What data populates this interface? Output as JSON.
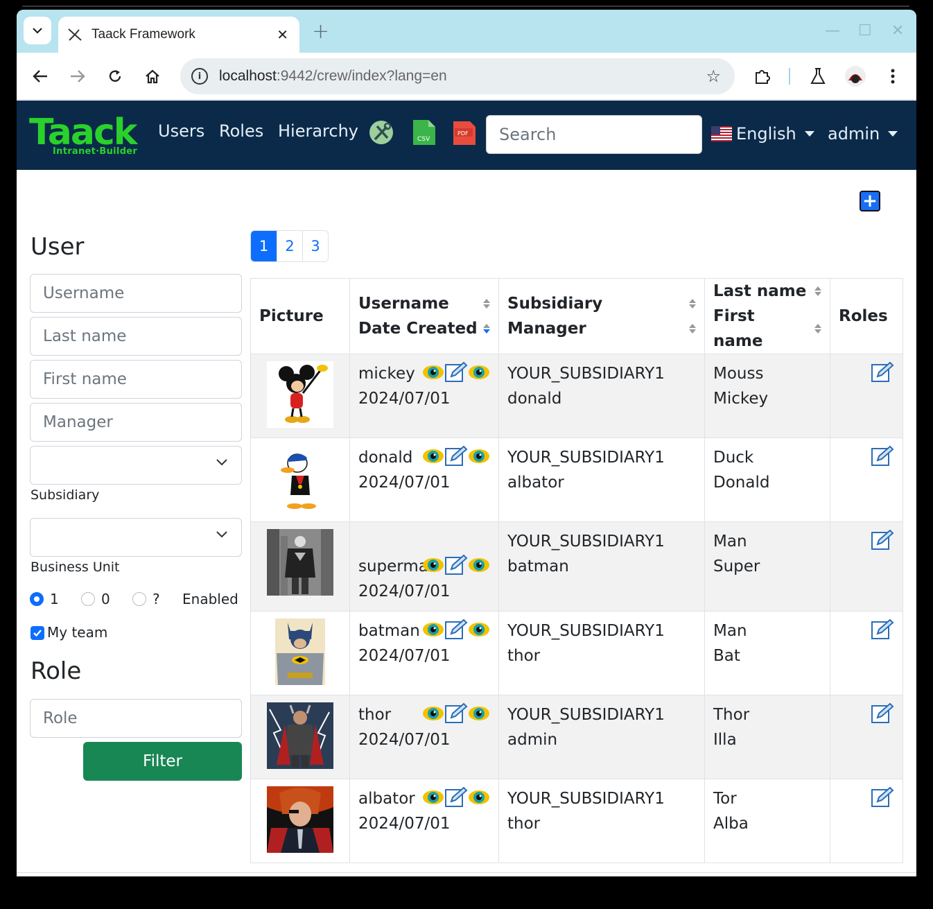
{
  "browser": {
    "tab_title": "Taack Framework",
    "url_host": "localhost",
    "url_rest": ":9442/crew/index?lang=en"
  },
  "app": {
    "logo_main": "Taack",
    "logo_sub": "Intranet·Builder",
    "nav": [
      "Users",
      "Roles",
      "Hierarchy"
    ],
    "search_placeholder": "Search",
    "language": "English",
    "user": "admin",
    "colors": {
      "navbar": "#0b2a4a",
      "logo": "#2bd12b",
      "primary": "#0d6efd",
      "filter_button": "#198754"
    }
  },
  "filter": {
    "user_title": "User",
    "fields": [
      "Username",
      "Last name",
      "First name",
      "Manager"
    ],
    "subsidiary_label": "Subsidiary",
    "business_unit_label": "Business Unit",
    "enabled_options": [
      "1",
      "0",
      "?"
    ],
    "enabled_selected": "1",
    "enabled_label": "Enabled",
    "my_team_label": "My team",
    "my_team_checked": true,
    "role_title": "Role",
    "role_placeholder": "Role",
    "filter_button": "Filter"
  },
  "pagination": {
    "pages": [
      "1",
      "2",
      "3"
    ],
    "active": "1"
  },
  "table": {
    "headers": {
      "picture": "Picture",
      "username": "Username",
      "date_created": "Date Created",
      "subsidiary": "Subsidiary",
      "manager": "Manager",
      "last_name": "Last name",
      "first_name": "First name",
      "roles": "Roles"
    },
    "rows": [
      {
        "username": "mickey",
        "date": "2024/07/01",
        "subsidiary": "YOUR_SUBSIDIARY1",
        "manager": "donald",
        "last_name": "Mouss",
        "first_name": "Mickey",
        "picture": "mickey"
      },
      {
        "username": "donald",
        "date": "2024/07/01",
        "subsidiary": "YOUR_SUBSIDIARY1",
        "manager": "albator",
        "last_name": "Duck",
        "first_name": "Donald",
        "picture": "donald"
      },
      {
        "username": "superman",
        "date": "2024/07/01",
        "subsidiary": "YOUR_SUBSIDIARY1",
        "manager": "batman",
        "last_name": "Man",
        "first_name": "Super",
        "picture": "superman"
      },
      {
        "username": "batman",
        "date": "2024/07/01",
        "subsidiary": "YOUR_SUBSIDIARY1",
        "manager": "thor",
        "last_name": "Man",
        "first_name": "Bat",
        "picture": "batman"
      },
      {
        "username": "thor",
        "date": "2024/07/01",
        "subsidiary": "YOUR_SUBSIDIARY1",
        "manager": "admin",
        "last_name": "Thor",
        "first_name": "Illa",
        "picture": "thor"
      },
      {
        "username": "albator",
        "date": "2024/07/01",
        "subsidiary": "YOUR_SUBSIDIARY1",
        "manager": "thor",
        "last_name": "Tor",
        "first_name": "Alba",
        "picture": "albator"
      }
    ]
  },
  "icons": {
    "csv_label": "CSV",
    "pdf_label": "PDF"
  }
}
